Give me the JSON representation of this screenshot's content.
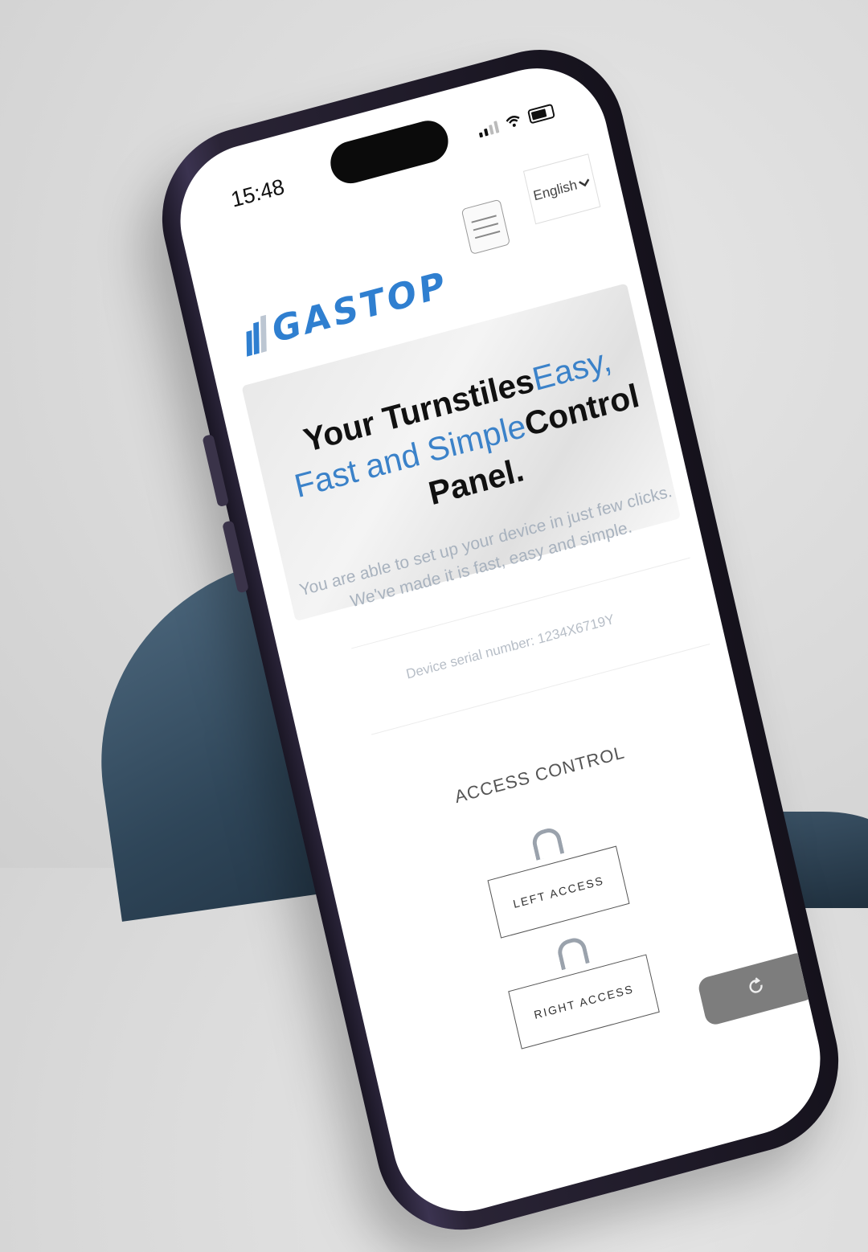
{
  "status_bar": {
    "time": "15:48"
  },
  "header": {
    "language_label": "English",
    "logo_text": "GASTOP"
  },
  "hero": {
    "title_part1": "Your Turnstiles",
    "title_highlight1": "Easy, Fast and Simple",
    "title_part2": "Control Panel.",
    "description_line1": "You are able to set up your device in just few clicks.",
    "description_line2": "We've made it is fast, easy and simple."
  },
  "device": {
    "serial_text": "Device serial number: 1234X6719Y"
  },
  "access_control": {
    "title": "ACCESS CONTROL",
    "left_label": "LEFT ACCESS",
    "right_label": "RIGHT ACCESS"
  },
  "colors": {
    "brand": "#2f7fd0",
    "accent_text": "#3b82c9"
  },
  "icons": [
    "wifi-icon",
    "battery-icon",
    "hamburger-icon",
    "chevron-down-icon",
    "arch-icon",
    "refresh-icon"
  ]
}
